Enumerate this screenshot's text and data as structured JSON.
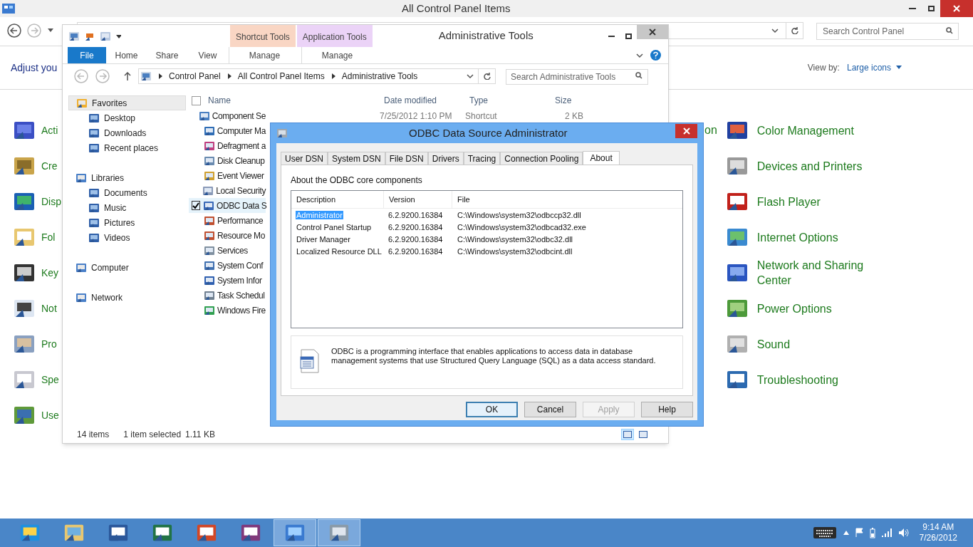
{
  "control_panel": {
    "title": "All Control Panel Items",
    "search": {
      "placeholder": "Search Control Panel"
    },
    "heading": "Adjust you",
    "view_by": {
      "label": "View by:",
      "value": "Large icons"
    },
    "left_items": [
      "Acti",
      "Cre",
      "Disp",
      "Fol",
      "Key",
      "Not",
      "Pro",
      "Spe",
      "Use"
    ],
    "middle_item": "on",
    "right_items": [
      "Color Management",
      "Devices and Printers",
      "Flash Player",
      "Internet Options",
      "Network and Sharing Center",
      "Power Options",
      "Sound",
      "Troubleshooting"
    ]
  },
  "explorer": {
    "title": "Administrative Tools",
    "context_tabs": [
      {
        "label": "Shortcut Tools",
        "color": "#f9d6c4"
      },
      {
        "label": "Application Tools",
        "color": "#ebd3f7"
      }
    ],
    "ribbon_tabs": [
      {
        "label": "File",
        "kind": "file"
      },
      {
        "label": "Home",
        "kind": "plain"
      },
      {
        "label": "Share",
        "kind": "plain"
      },
      {
        "label": "View",
        "kind": "plain"
      },
      {
        "label": "Manage",
        "kind": "context"
      },
      {
        "label": "Manage",
        "kind": "context"
      }
    ],
    "breadcrumb": [
      "Control Panel",
      "All Control Panel Items",
      "Administrative Tools"
    ],
    "search": {
      "placeholder": "Search Administrative Tools"
    },
    "nav": [
      {
        "label": "Favorites",
        "selected": true,
        "children": [
          {
            "label": "Desktop",
            "selected": false
          },
          {
            "label": "Downloads",
            "selected": false
          },
          {
            "label": "Recent places",
            "selected": false
          }
        ]
      },
      {
        "label": "Libraries",
        "selected": false,
        "children": [
          {
            "label": "Documents",
            "selected": false
          },
          {
            "label": "Music",
            "selected": false
          },
          {
            "label": "Pictures",
            "selected": false
          },
          {
            "label": "Videos",
            "selected": false
          }
        ]
      },
      {
        "label": "Computer",
        "selected": false
      },
      {
        "label": "Network",
        "selected": false
      }
    ],
    "select_all": {
      "checked": false
    },
    "columns": [
      "Name",
      "Date modified",
      "Type",
      "Size"
    ],
    "files": [
      {
        "name": "Component Se",
        "date_modified": "7/25/2012 1:10 PM",
        "type": "Shortcut",
        "size": "2 KB",
        "selected": false
      },
      {
        "name": "Computer Ma",
        "selected": false
      },
      {
        "name": "Defragment a",
        "selected": false
      },
      {
        "name": "Disk Cleanup",
        "selected": false
      },
      {
        "name": "Event Viewer",
        "selected": false
      },
      {
        "name": "Local Security",
        "selected": false
      },
      {
        "name": "ODBC Data S",
        "selected": true
      },
      {
        "name": "Performance",
        "selected": false
      },
      {
        "name": "Resource Mo",
        "selected": false
      },
      {
        "name": "Services",
        "selected": false
      },
      {
        "name": "System Conf",
        "selected": false
      },
      {
        "name": "System Infor",
        "selected": false
      },
      {
        "name": "Task Schedul",
        "selected": false
      },
      {
        "name": "Windows Fire",
        "selected": false
      }
    ],
    "status": {
      "count": "14 items",
      "selection": "1 item selected",
      "size": "1.11 KB"
    },
    "view_buttons": [
      {
        "selected": true
      },
      {
        "selected": false
      }
    ]
  },
  "odbc": {
    "title": "ODBC Data Source Administrator",
    "tabs": [
      {
        "label": "User DSN",
        "selected": false
      },
      {
        "label": "System DSN",
        "selected": false
      },
      {
        "label": "File DSN",
        "selected": false
      },
      {
        "label": "Drivers",
        "selected": false
      },
      {
        "label": "Tracing",
        "selected": false
      },
      {
        "label": "Connection Pooling",
        "selected": false
      },
      {
        "label": "About",
        "selected": true
      }
    ],
    "section_label": "About the ODBC core components",
    "columns": [
      "Description",
      "Version",
      "File"
    ],
    "rows": [
      {
        "description": "Administrator",
        "version": "6.2.9200.16384",
        "file": "C:\\Windows\\system32\\odbccp32.dll",
        "selected": true
      },
      {
        "description": "Control Panel Startup",
        "version": "6.2.9200.16384",
        "file": "C:\\Windows\\system32\\odbcad32.exe",
        "selected": false
      },
      {
        "description": "Driver Manager",
        "version": "6.2.9200.16384",
        "file": "C:\\Windows\\system32\\odbc32.dll",
        "selected": false
      },
      {
        "description": "Localized Resource DLL",
        "version": "6.2.9200.16384",
        "file": "C:\\Windows\\system32\\odbcint.dll",
        "selected": false
      }
    ],
    "info": "ODBC is a programming interface that enables applications to access data in database management systems that use Structured Query Language (SQL) as a data access standard.",
    "buttons": [
      {
        "label": "OK",
        "default": true,
        "disabled": false
      },
      {
        "label": "Cancel",
        "default": false,
        "disabled": false
      },
      {
        "label": "Apply",
        "default": false,
        "disabled": true
      },
      {
        "label": "Help",
        "default": false,
        "disabled": false
      }
    ]
  },
  "taskbar": {
    "apps": [
      {
        "active": false
      },
      {
        "active": false
      },
      {
        "active": false
      },
      {
        "active": false
      },
      {
        "active": false
      },
      {
        "active": false
      },
      {
        "active": true
      },
      {
        "active": true
      }
    ],
    "time": "9:14 AM",
    "date": "7/26/2012"
  }
}
